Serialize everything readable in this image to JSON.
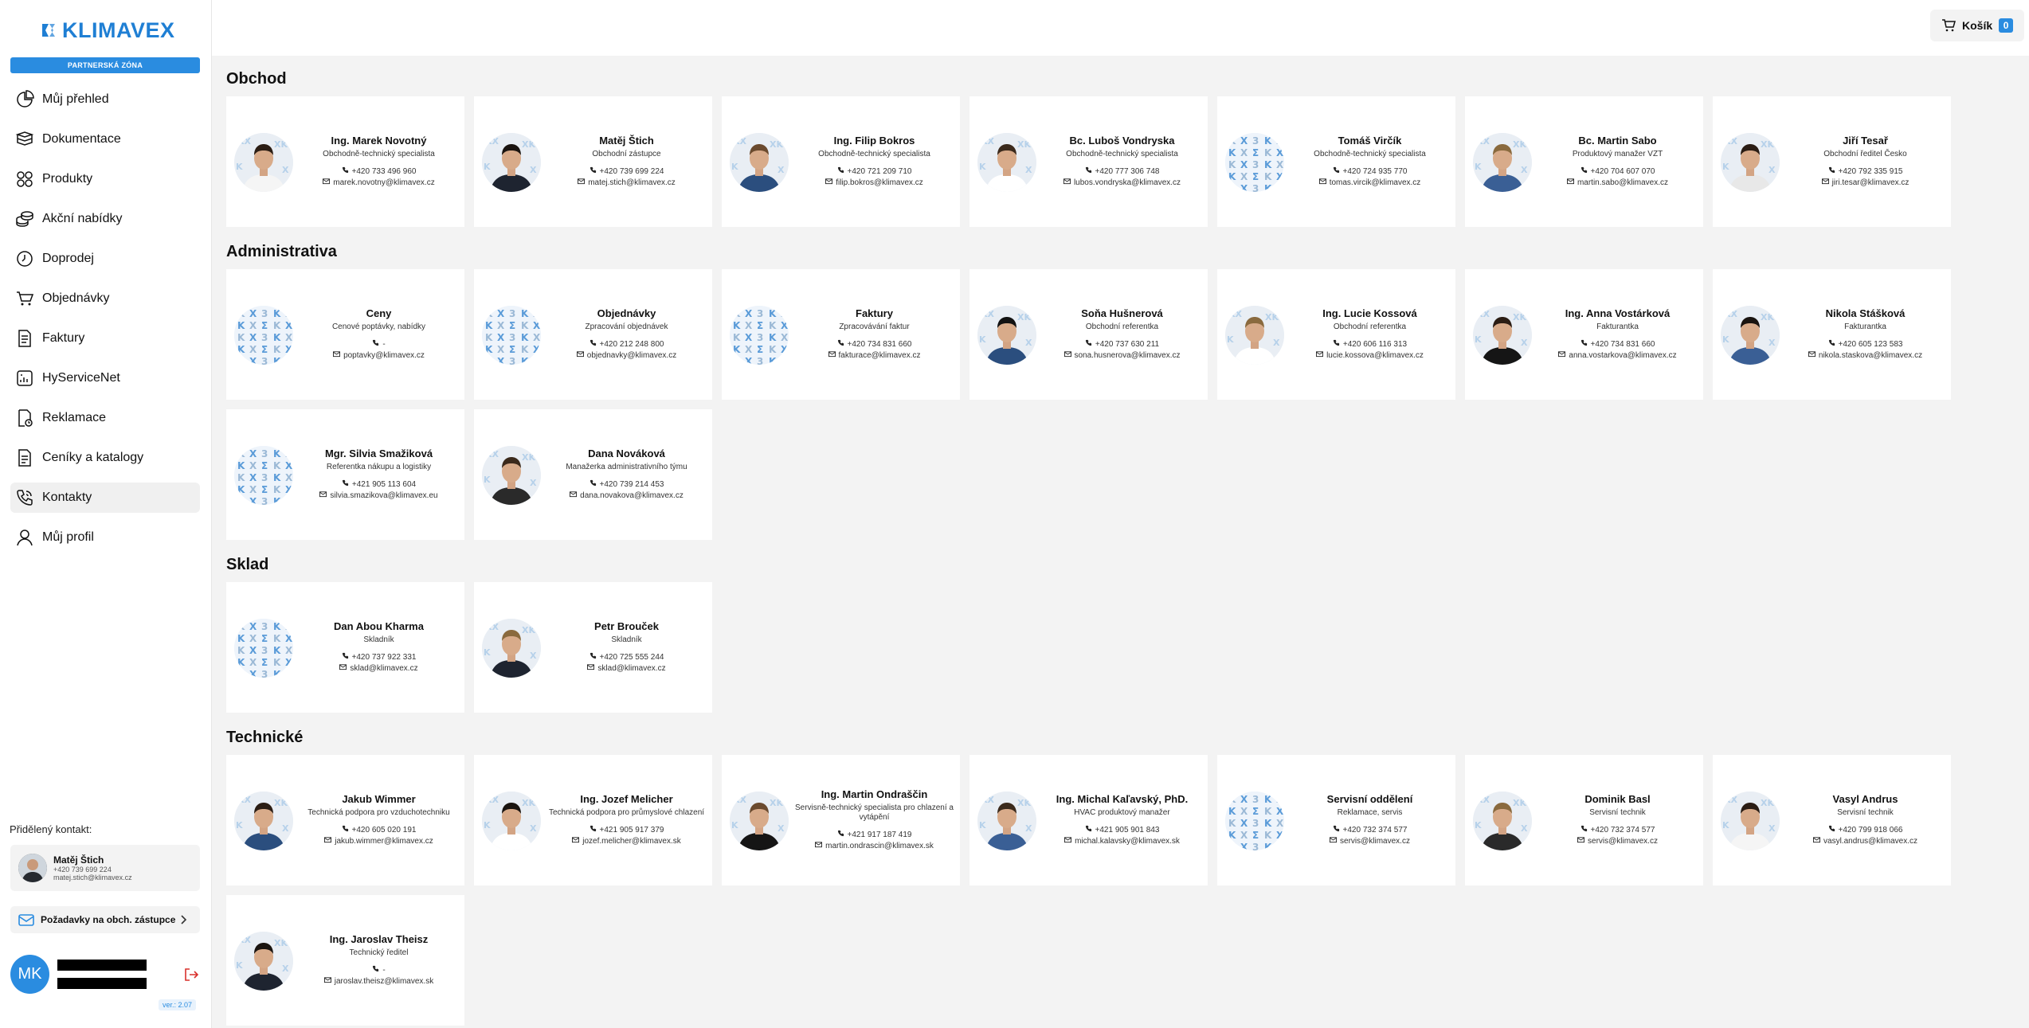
{
  "brand": {
    "logo": "KLIMAVEX",
    "zone": "PARTNERSKÁ ZÓNA"
  },
  "nav": [
    {
      "label": "Můj přehled",
      "icon": "pie-chart-icon"
    },
    {
      "label": "Dokumentace",
      "icon": "books-icon"
    },
    {
      "label": "Produkty",
      "icon": "grid-icon"
    },
    {
      "label": "Akční nabídky",
      "icon": "coins-icon"
    },
    {
      "label": "Doprodej",
      "icon": "clock-icon"
    },
    {
      "label": "Objednávky",
      "icon": "cart-icon"
    },
    {
      "label": "Faktury",
      "icon": "document-icon"
    },
    {
      "label": "HyServiceNet",
      "icon": "chip-icon"
    },
    {
      "label": "Reklamace",
      "icon": "complaint-icon"
    },
    {
      "label": "Ceníky a katalogy",
      "icon": "pricelist-icon"
    },
    {
      "label": "Kontakty",
      "icon": "phone-icon"
    },
    {
      "label": "Můj profil",
      "icon": "user-icon"
    }
  ],
  "assigned": {
    "label": "Přidělený kontakt:",
    "name": "Matěj Štich",
    "phone": "+420 739 699 224",
    "email": "matej.stich@klimavex.cz"
  },
  "request_button": "Požadavky na obch. zástupce",
  "user": {
    "initials": "MK",
    "version": "ver.: 2.07"
  },
  "cart": {
    "label": "Košík",
    "count": "0"
  },
  "sections": [
    {
      "title": "Obchod",
      "contacts": [
        {
          "name": "Ing. Marek Novotný",
          "role": "Obchodně-technický specialista",
          "phone": "+420 733 496 960",
          "email": "marek.novotny@klimavex.cz",
          "photo": "person"
        },
        {
          "name": "Matěj Štich",
          "role": "Obchodní zástupce",
          "phone": "+420 739 699 224",
          "email": "matej.stich@klimavex.cz",
          "photo": "person"
        },
        {
          "name": "Ing. Filip Bokros",
          "role": "Obchodně-technický specialista",
          "phone": "+420 721 209 710",
          "email": "filip.bokros@klimavex.cz",
          "photo": "person"
        },
        {
          "name": "Bc. Luboš Vondryska",
          "role": "Obchodně-technický specialista",
          "phone": "+420 777 306 748",
          "email": "lubos.vondryska@klimavex.cz",
          "photo": "person"
        },
        {
          "name": "Tomáš Virčík",
          "role": "Obchodně-technický specialista",
          "phone": "+420 724 935 770",
          "email": "tomas.vircik@klimavex.cz",
          "photo": "logo"
        },
        {
          "name": "Bc. Martin Sabo",
          "role": "Produktový manažer VZT",
          "phone": "+420 704 607 070",
          "email": "martin.sabo@klimavex.cz",
          "photo": "person"
        },
        {
          "name": "Jiří Tesař",
          "role": "Obchodní ředitel Česko",
          "phone": "+420 792 335 915",
          "email": "jiri.tesar@klimavex.cz",
          "photo": "person"
        }
      ]
    },
    {
      "title": "Administrativa",
      "contacts": [
        {
          "name": "Ceny",
          "role": "Cenové poptávky, nabídky",
          "phone": "-",
          "email": "poptavky@klimavex.cz",
          "photo": "logo"
        },
        {
          "name": "Objednávky",
          "role": "Zpracování objednávek",
          "phone": "+420 212 248 800",
          "email": "objednavky@klimavex.cz",
          "photo": "logo"
        },
        {
          "name": "Faktury",
          "role": "Zpracovávání faktur",
          "phone": "+420 734 831 660",
          "email": "fakturace@klimavex.cz",
          "photo": "logo"
        },
        {
          "name": "Soňa Hušnerová",
          "role": "Obchodní referentka",
          "phone": "+420 737 630 211",
          "email": "sona.husnerova@klimavex.cz",
          "photo": "person"
        },
        {
          "name": "Ing. Lucie Kossová",
          "role": "Obchodní referentka",
          "phone": "+420 606 116 313",
          "email": "lucie.kossova@klimavex.cz",
          "photo": "person"
        },
        {
          "name": "Ing. Anna Vostárková",
          "role": "Fakturantka",
          "phone": "+420 734 831 660",
          "email": "anna.vostarkova@klimavex.cz",
          "photo": "person"
        },
        {
          "name": "Nikola Stášková",
          "role": "Fakturantka",
          "phone": "+420 605 123 583",
          "email": "nikola.staskova@klimavex.cz",
          "photo": "person"
        },
        {
          "name": "Mgr. Silvia Smažiková",
          "role": "Referentka nákupu a logistiky",
          "phone": "+421 905 113 604",
          "email": "silvia.smazikova@klimavex.eu",
          "photo": "logo"
        },
        {
          "name": "Dana Nováková",
          "role": "Manažerka administrativního týmu",
          "phone": "+420 739 214 453",
          "email": "dana.novakova@klimavex.cz",
          "photo": "person"
        }
      ]
    },
    {
      "title": "Sklad",
      "contacts": [
        {
          "name": "Dan Abou Kharma",
          "role": "Skladník",
          "phone": "+420 737 922 331",
          "email": "sklad@klimavex.cz",
          "photo": "logo"
        },
        {
          "name": "Petr Brouček",
          "role": "Skladník",
          "phone": "+420 725 555 244",
          "email": "sklad@klimavex.cz",
          "photo": "person"
        }
      ]
    },
    {
      "title": "Technické",
      "contacts": [
        {
          "name": "Jakub Wimmer",
          "role": "Technická podpora pro vzduchotechniku",
          "phone": "+420 605 020 191",
          "email": "jakub.wimmer@klimavex.cz",
          "photo": "person"
        },
        {
          "name": "Ing. Jozef Melicher",
          "role": "Technická podpora pro průmyslové chlazení",
          "phone": "+421 905 917 379",
          "email": "jozef.melicher@klimavex.sk",
          "photo": "person"
        },
        {
          "name": "Ing. Martin Ondraščin",
          "role": "Servisně-technický specialista pro chlazení a vytápění",
          "phone": "+421 917 187 419",
          "email": "martin.ondrascin@klimavex.sk",
          "photo": "person"
        },
        {
          "name": "Ing. Michal Kaľavský, PhD.",
          "role": "HVAC produktový manažer",
          "phone": "+421 905 901 843",
          "email": "michal.kalavsky@klimavex.sk",
          "photo": "person"
        },
        {
          "name": "Servisní oddělení",
          "role": "Reklamace, servis",
          "phone": "+420 732 374 577",
          "email": "servis@klimavex.cz",
          "photo": "logo"
        },
        {
          "name": "Dominik Basl",
          "role": "Servisní technik",
          "phone": "+420 732 374 577",
          "email": "servis@klimavex.cz",
          "photo": "person"
        },
        {
          "name": "Vasyl Andrus",
          "role": "Servisní technik",
          "phone": "+420 799 918 066",
          "email": "vasyl.andrus@klimavex.cz",
          "photo": "person"
        },
        {
          "name": "Ing. Jaroslav Theisz",
          "role": "Technický ředitel",
          "phone": "-",
          "email": "jaroslav.theisz@klimavex.sk",
          "photo": "person"
        }
      ]
    }
  ],
  "colors": {
    "accent": "#2a8ce0",
    "active_nav": "#f0f0f0",
    "bg": "#f3f3f3"
  }
}
